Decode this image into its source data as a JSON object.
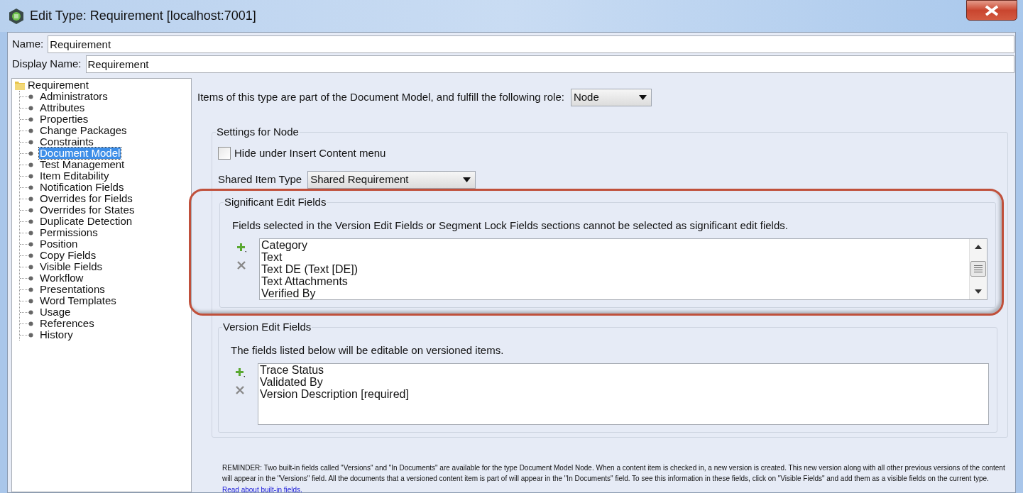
{
  "window": {
    "title": "Edit Type: Requirement [localhost:7001]"
  },
  "fields": [
    {
      "label": "Name:",
      "value": "Requirement"
    },
    {
      "label": "Display Name:",
      "value": "Requirement"
    }
  ],
  "tree": {
    "label": "Requirement",
    "children": [
      {
        "label": "Administrators",
        "selected": false
      },
      {
        "label": "Attributes",
        "selected": false
      },
      {
        "label": "Properties",
        "selected": false
      },
      {
        "label": "Change Packages",
        "selected": false
      },
      {
        "label": "Constraints",
        "selected": false
      },
      {
        "label": "Document Model",
        "selected": true
      },
      {
        "label": "Test Management",
        "selected": false
      },
      {
        "label": "Item Editability",
        "selected": false
      },
      {
        "label": "Notification Fields",
        "selected": false
      },
      {
        "label": "Overrides for Fields",
        "selected": false
      },
      {
        "label": "Overrides for States",
        "selected": false
      },
      {
        "label": "Duplicate Detection",
        "selected": false
      },
      {
        "label": "Permissions",
        "selected": false
      },
      {
        "label": "Position",
        "selected": false
      },
      {
        "label": "Copy Fields",
        "selected": false
      },
      {
        "label": "Visible Fields",
        "selected": false
      },
      {
        "label": "Workflow",
        "selected": false
      },
      {
        "label": "Presentations",
        "selected": false
      },
      {
        "label": "Word Templates",
        "selected": false
      },
      {
        "label": "Usage",
        "selected": false
      },
      {
        "label": "References",
        "selected": false
      },
      {
        "label": "History",
        "selected": false
      }
    ]
  },
  "role": {
    "label": "Items of this type are part of the Document Model, and fulfill the following role:",
    "value": "Node"
  },
  "node_settings": {
    "title": "Settings for Node",
    "hide_checkbox": {
      "label": "Hide under Insert Content menu",
      "checked": false
    },
    "shared_item_type": {
      "label": "Shared Item Type",
      "value": "Shared Requirement"
    }
  },
  "significant_edit_fields": {
    "title": "Significant Edit Fields",
    "highlighted": true,
    "description": "Fields selected in the Version Edit Fields or Segment Lock Fields sections cannot be selected as significant edit fields.",
    "items": [
      "Category",
      "Text",
      "Text DE (Text [DE])",
      "Text Attachments",
      "Verified By"
    ]
  },
  "version_edit_fields": {
    "title": "Version Edit Fields",
    "highlighted": false,
    "description": "The fields listed below will be editable on versioned items.",
    "items": [
      "Trace Status",
      "Validated By",
      "Version Description [required]"
    ]
  },
  "reminder": {
    "text": "REMINDER: Two built-in fields called \"Versions\" and \"In Documents\" are available for the type Document Model Node. When a content item is checked in, a new version is created. This new version along with all other previous versions of the content will appear in the \"Versions\" field. All the documents that a versioned content item is part of will appear in the \"In Documents\" field. To see this information in these fields, click on \"Visible Fields\" and add them as a visible fields on the current type.",
    "link": "Read about built-in fields."
  }
}
